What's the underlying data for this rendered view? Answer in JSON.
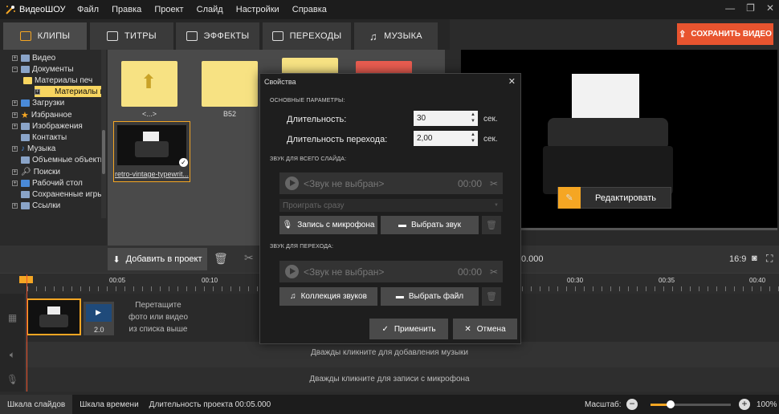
{
  "app": {
    "title": "ВидеоШОУ"
  },
  "menu": [
    "Файл",
    "Правка",
    "Проект",
    "Слайд",
    "Настройки",
    "Справка"
  ],
  "tabs": [
    {
      "label": "КЛИПЫ",
      "icon": "film-icon"
    },
    {
      "label": "ТИТРЫ",
      "icon": "text-bubble-icon"
    },
    {
      "label": "ЭФФЕКТЫ",
      "icon": "effects-icon"
    },
    {
      "label": "ПЕРЕХОДЫ",
      "icon": "transitions-icon"
    },
    {
      "label": "МУЗЫКА",
      "icon": "music-note-icon"
    }
  ],
  "save_button": "СОХРАНИТЬ ВИДЕО",
  "tree": [
    {
      "label": "Видео"
    },
    {
      "label": "Документы"
    },
    {
      "label": "Материалы печ"
    },
    {
      "label": "Материалы г"
    },
    {
      "label": "Загрузки"
    },
    {
      "label": "Избранное"
    },
    {
      "label": "Изображения"
    },
    {
      "label": "Контакты"
    },
    {
      "label": "Музыка"
    },
    {
      "label": "Объемные объекты"
    },
    {
      "label": "Поиски"
    },
    {
      "label": "Рабочий стол"
    },
    {
      "label": "Сохраненные игры"
    },
    {
      "label": "Ссылки"
    }
  ],
  "files": [
    {
      "label": "<...>"
    },
    {
      "label": "B52"
    },
    {
      "label": ""
    },
    {
      "label": ""
    },
    {
      "label": "retro-vintage-typewrit..."
    }
  ],
  "preview": {
    "edit_button": "Редактировать",
    "time": "0.000",
    "aspect": "16:9"
  },
  "toolbar": {
    "add_button": "Добавить в проект"
  },
  "ruler": [
    "00:05",
    "00:10",
    "00:30",
    "00:35",
    "00:40"
  ],
  "timeline": {
    "transition_duration": "2.0",
    "drag_hint_line1": "Перетащите",
    "drag_hint_line2": "фото или видео",
    "drag_hint_line3": "из списка выше",
    "music_hint": "Дважды кликните для добавления музыки",
    "mic_hint": "Дважды кликните для записи с микрофона"
  },
  "status": {
    "slides_tab": "Шкала слайдов",
    "time_tab": "Шкала времени",
    "duration": "Длительность проекта 00:05.000",
    "zoom_label": "Масштаб:",
    "zoom_value": "100%",
    "zoom_fraction": 0.25
  },
  "dialog": {
    "title": "Свойства",
    "basic_section": "ОСНОВНЫЕ ПАРАМЕТРЫ:",
    "duration_label": "Длительность:",
    "duration_value": "30",
    "transition_label": "Длительность перехода:",
    "transition_value": "2,00",
    "unit": "сек.",
    "slide_sound_section": "ЗВУК ДЛЯ ВСЕГО СЛАЙДА:",
    "no_sound": "<Звук не выбран>",
    "sound_time": "00:00",
    "play_mode": "Проиграть сразу",
    "mic_button": "Запись с микрофона",
    "choose_sound_button": "Выбрать звук",
    "transition_sound_section": "ЗВУК ДЛЯ ПЕРЕХОДА:",
    "collection_button": "Коллекция звуков",
    "choose_file_button": "Выбрать файл",
    "apply_button": "Применить",
    "cancel_button": "Отмена"
  },
  "colors": {
    "accent": "#f5a623",
    "save": "#e8542f",
    "folder": "#f7e283"
  }
}
